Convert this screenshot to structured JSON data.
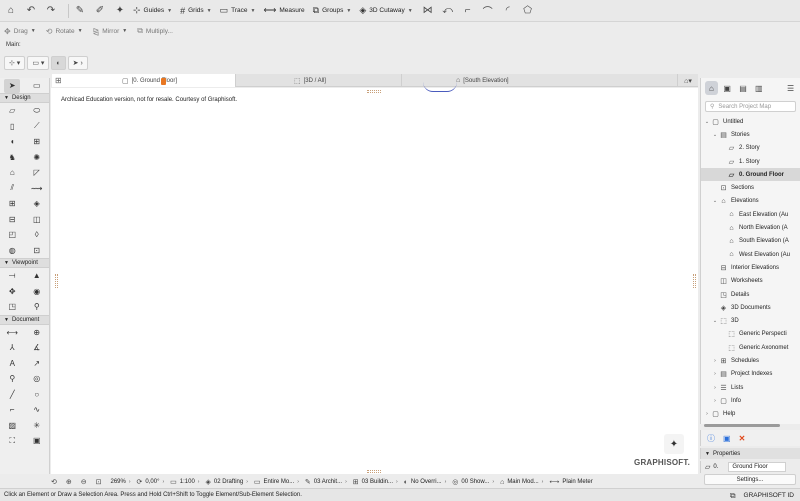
{
  "toolbar": {
    "guides": "Guides",
    "grids": "Grids",
    "trace": "Trace",
    "measure": "Measure",
    "groups": "Groups",
    "cutaway": "3D Cutaway"
  },
  "toolbar2": {
    "drag": "Drag",
    "rotate": "Rotate",
    "mirror": "Mirror",
    "multiply": "Multiply..."
  },
  "infobox": {
    "label": "Main:"
  },
  "tabs": [
    {
      "label": "[0. Ground Floor]"
    },
    {
      "label": "[3D / All]"
    },
    {
      "label": "[South Elevation]"
    }
  ],
  "toolbox": {
    "design": "Design",
    "viewpoint": "Viewpoint",
    "document": "Document"
  },
  "canvas": {
    "note": "Archicad Education version, not for resale. Courtesy of Graphisoft.",
    "logo": "GRAPHISOFT."
  },
  "navigator": {
    "search_placeholder": "Search Project Map",
    "items": [
      {
        "label": "Untitled"
      },
      {
        "label": "Stories"
      },
      {
        "label": "2. Story"
      },
      {
        "label": "1. Story"
      },
      {
        "label": "0. Ground Floor"
      },
      {
        "label": "Sections"
      },
      {
        "label": "Elevations"
      },
      {
        "label": "East Elevation (Au"
      },
      {
        "label": "North Elevation (A"
      },
      {
        "label": "South Elevation (A"
      },
      {
        "label": "West Elevation (Au"
      },
      {
        "label": "Interior Elevations"
      },
      {
        "label": "Worksheets"
      },
      {
        "label": "Details"
      },
      {
        "label": "3D Documents"
      },
      {
        "label": "3D"
      },
      {
        "label": "Generic Perspecti"
      },
      {
        "label": "Generic Axonomet"
      },
      {
        "label": "Schedules"
      },
      {
        "label": "Project Indexes"
      },
      {
        "label": "Lists"
      },
      {
        "label": "Info"
      },
      {
        "label": "Help"
      }
    ]
  },
  "properties": {
    "title": "Properties",
    "id": "0.",
    "name": "Ground Floor",
    "settings": "Settings..."
  },
  "bottombar": {
    "zoom": "269%",
    "angle": "0,00°",
    "scale": "1:100",
    "layer": "02 Drafting",
    "model": "Entire Mo...",
    "arch": "03 Archit...",
    "building": "03 Buildin...",
    "override": "No Overri...",
    "show": "00 Show...",
    "mainmod": "Main Mod...",
    "meter": "Plain Meter"
  },
  "status": {
    "message": "Click an Element or Draw a Selection Area. Press and Hold Ctrl+Shift to Toggle Element/Sub-Element Selection.",
    "brand": "GRAPHISOFT ID"
  }
}
